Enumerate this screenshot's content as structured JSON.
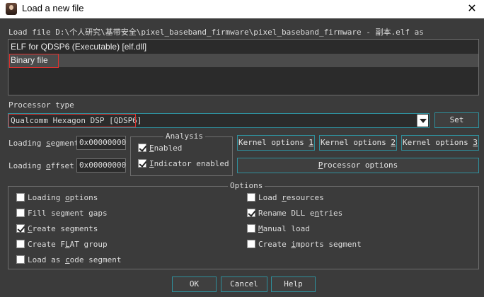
{
  "window": {
    "title": "Load a new file",
    "close_glyph": "✕"
  },
  "load_file_line": "Load file D:\\个人研究\\基带安全\\pixel_baseband_firmware\\pixel_baseband_firmware - 副本.elf as",
  "file_types": [
    {
      "label": "ELF for QDSP6 (Executable) [elf.dll]",
      "selected": false
    },
    {
      "label": "Binary file",
      "selected": true
    }
  ],
  "processor": {
    "label": "Processor type",
    "value": "Qualcomm Hexagon DSP [QDSP6]",
    "set_button": "Set"
  },
  "loading": {
    "segment_label": "Loading segment",
    "segment_value": "0x00000000",
    "offset_label": "Loading offset",
    "offset_value": "0x00000000"
  },
  "analysis": {
    "title": "Analysis",
    "enabled_label": "Enabled",
    "enabled_checked": true,
    "indicator_label": "Indicator enabled",
    "indicator_checked": true
  },
  "kernel_buttons": [
    "Kernel options 1",
    "Kernel options 2",
    "Kernel options 3"
  ],
  "processor_options_button": "Processor options",
  "options": {
    "title": "Options",
    "left": [
      {
        "label": "Loading options",
        "checked": false
      },
      {
        "label": "Fill segment gaps",
        "checked": false
      },
      {
        "label": "Create segments",
        "checked": true
      },
      {
        "label": "Create FLAT group",
        "checked": false
      },
      {
        "label": "Load as code segment",
        "checked": false
      }
    ],
    "right": [
      {
        "label": "Load resources",
        "checked": false
      },
      {
        "label": "Rename DLL entries",
        "checked": true
      },
      {
        "label": "Manual load",
        "checked": false
      },
      {
        "label": "Create imports segment",
        "checked": false
      }
    ]
  },
  "footer": {
    "ok": "OK",
    "cancel": "Cancel",
    "help": "Help"
  },
  "colors": {
    "background": "#3b3b3b",
    "accent_teal": "#2f8f9c",
    "highlight_red": "#e0312e"
  }
}
